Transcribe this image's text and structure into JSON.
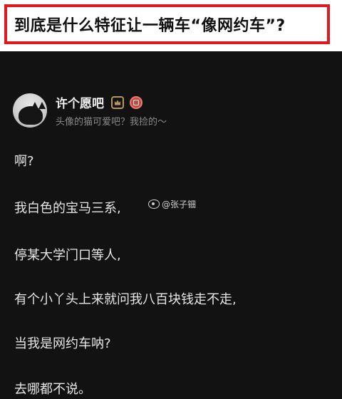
{
  "title_banner": {
    "text": "到底是什么特征让一辆车“像网约车”?",
    "border_color": "#e0191f"
  },
  "post": {
    "author": {
      "name": "许个愿吧",
      "bio": "头像的猫可爱吧？我捡的～",
      "avatar_icon": "black-cat-avatar",
      "badges": [
        "level-crown-badge",
        "red-verified-badge"
      ]
    },
    "lines": [
      "啊?",
      "我白色的宝马三系,",
      "停某大学门口等人,",
      "有个小丫头上来就问我八百块钱走不走,",
      "当我是网约车呐?",
      "去哪都不说。"
    ],
    "watermark": "@张子钿",
    "watermark_icon": "weibo-icon",
    "background_color": "#121212"
  }
}
